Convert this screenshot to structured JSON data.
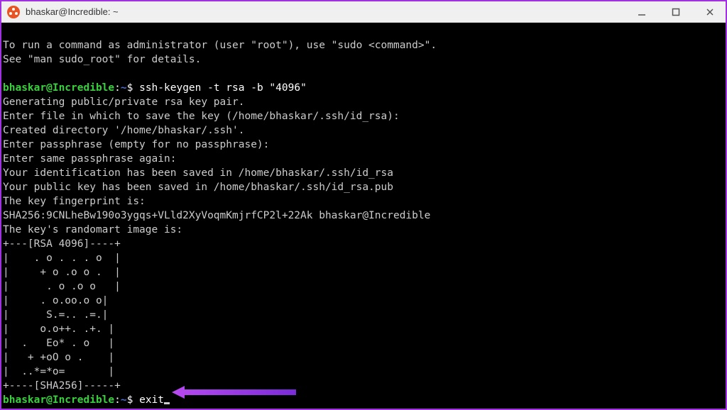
{
  "window": {
    "title": "bhaskar@Incredible: ~"
  },
  "prompt": {
    "user": "bhaskar",
    "at": "@",
    "host": "Incredible",
    "colon": ":",
    "path": "~",
    "dollar": "$ "
  },
  "lines": {
    "l1": "To run a command as administrator (user \"root\"), use \"sudo <command>\".",
    "l2": "See \"man sudo_root\" for details.",
    "blank1": " ",
    "cmd1": "ssh-keygen -t rsa -b \"4096\"",
    "g1": "Generating public/private rsa key pair.",
    "g2": "Enter file in which to save the key (/home/bhaskar/.ssh/id_rsa):",
    "g3": "Created directory '/home/bhaskar/.ssh'.",
    "g4": "Enter passphrase (empty for no passphrase):",
    "g5": "Enter same passphrase again:",
    "g6": "Your identification has been saved in /home/bhaskar/.ssh/id_rsa",
    "g7": "Your public key has been saved in /home/bhaskar/.ssh/id_rsa.pub",
    "g8": "The key fingerprint is:",
    "g9": "SHA256:9CNLheBw190o3ygqs+VLld2XyVoqmKmjrfCP2l+22Ak bhaskar@Incredible",
    "g10": "The key's randomart image is:",
    "r1": "+---[RSA 4096]----+",
    "r2": "|    . o . . . o  |",
    "r3": "|     + o .o o .  |",
    "r4": "|      . o .o o   |",
    "r5": "|     . o.oo.o o|",
    "r6": "|      S.=.. .=.|",
    "r7": "|     o.o++. .+. |",
    "r8": "|  .   Eo* . o   |",
    "r9": "|   + +oO o .    |",
    "r10": "|  ..*=*o=       |",
    "r11": "+----[SHA256]-----+",
    "cmd2": "exit"
  }
}
